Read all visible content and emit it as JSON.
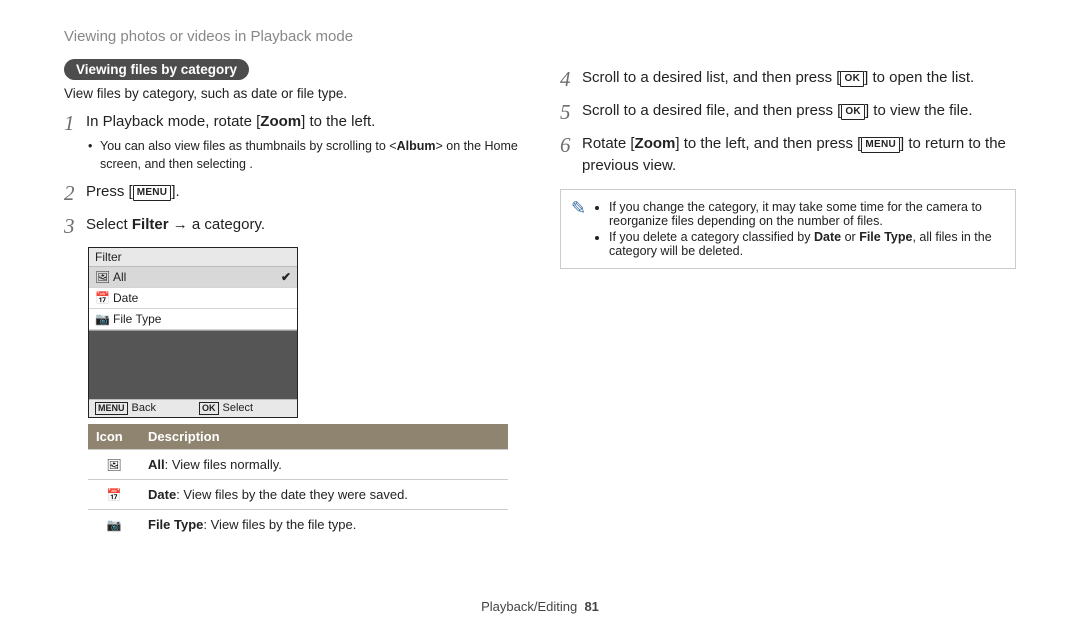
{
  "header": "Viewing photos or videos in Playback mode",
  "section": {
    "title": "Viewing files by category",
    "desc": "View files by category, such as date or file type."
  },
  "keys": {
    "menu": "MENU",
    "ok": "OK"
  },
  "steps": [
    {
      "n": "1",
      "pre": "In Playback mode, rotate",
      "key": "Zoom",
      "post": "to the left.",
      "sub_a": "You can also view files as thumbnails by scrolling to",
      "sub_tag": "Album",
      "sub_b": "on the Home screen, and then selecting      ."
    },
    {
      "n": "2",
      "pre": "Press"
    },
    {
      "n": "3",
      "pre": "Select",
      "bold": "Filter",
      "post": "a category."
    },
    {
      "n": "4",
      "pre": "Scroll to a desired list, and then press",
      "post": "to open the list."
    },
    {
      "n": "5",
      "pre": "Scroll to a desired file, and then press",
      "post": "to view the file."
    },
    {
      "n": "6",
      "pre": "Rotate",
      "key": "Zoom",
      "mid": "to the left, and then press",
      "post": "to return to the previous view."
    }
  ],
  "filterScreen": {
    "title": "Filter",
    "items": [
      "All",
      "Date",
      "File Type"
    ],
    "back": "Back",
    "select": "Select"
  },
  "iconTable": {
    "h1": "Icon",
    "h2": "Description",
    "rows": [
      {
        "b": "All",
        "t": ": View files normally."
      },
      {
        "b": "Date",
        "t": ": View files by the date they were saved."
      },
      {
        "b": "File Type",
        "t": ": View files by the file type."
      }
    ]
  },
  "note": {
    "0": "If you change the category, it may take some time for the camera to reorganize files depending on the number of files.",
    "1a": "If you delete a category classified by",
    "1b": "Date",
    "1c": "or",
    "1d": "File Type",
    "1e": ", all files in the category will be deleted."
  },
  "footer": {
    "section": "Playback/Editing",
    "page": "81"
  }
}
